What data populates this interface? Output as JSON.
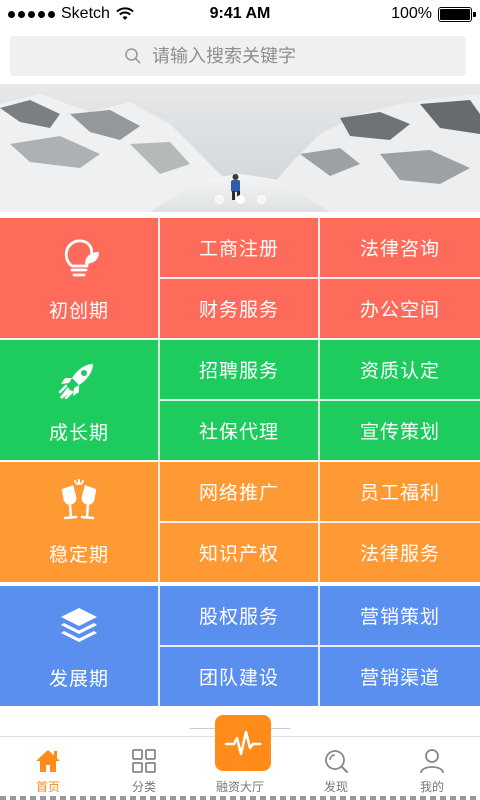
{
  "status_bar": {
    "carrier": "Sketch",
    "time": "9:41 AM",
    "battery": "100%"
  },
  "search": {
    "placeholder": "请输入搜索关键字"
  },
  "banner": {
    "pages": 3,
    "active_page": 2
  },
  "sections": [
    {
      "stage": "初创期",
      "color": "#ff6b5b",
      "icon": "lightbulb-leaf-icon",
      "services": [
        "工商注册",
        "法律咨询",
        "财务服务",
        "办公空间"
      ]
    },
    {
      "stage": "成长期",
      "color": "#1dcc5d",
      "icon": "rocket-icon",
      "services": [
        "招聘服务",
        "资质认定",
        "社保代理",
        "宣传策划"
      ]
    },
    {
      "stage": "稳定期",
      "color": "#ff9933",
      "icon": "champagne-glasses-icon",
      "services": [
        "网络推广",
        "员工福利",
        "知识产权",
        "法律服务"
      ]
    },
    {
      "stage": "发展期",
      "color": "#5a8ff0",
      "icon": "layers-icon",
      "services": [
        "股权服务",
        "营销策划",
        "团队建设",
        "营销渠道"
      ]
    }
  ],
  "tabbar": {
    "active_color": "#ff8c1a",
    "tabs": [
      {
        "label": "首页",
        "icon": "home-icon",
        "active": true
      },
      {
        "label": "分类",
        "icon": "grid-icon",
        "active": false
      },
      {
        "label": "融资大厅",
        "icon": "pulse-icon",
        "active": false
      },
      {
        "label": "发现",
        "icon": "discover-icon",
        "active": false
      },
      {
        "label": "我的",
        "icon": "user-icon",
        "active": false
      }
    ]
  }
}
